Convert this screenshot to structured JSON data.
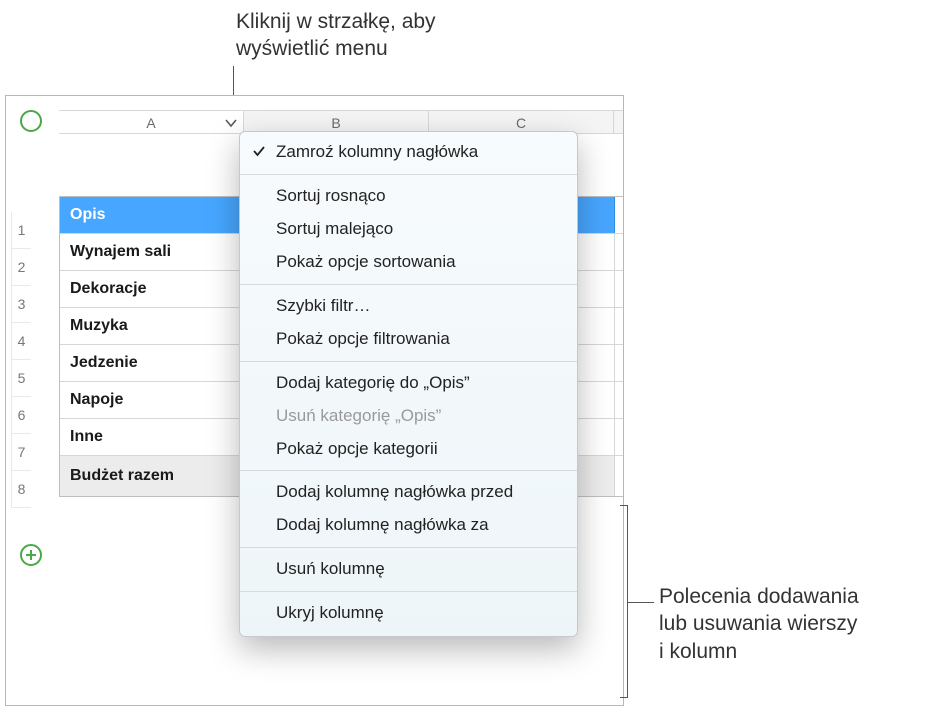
{
  "callouts": {
    "top_line1": "Kliknij w strzałkę, aby",
    "top_line2": "wyświetlić menu",
    "right_line1": "Polecenia dodawania",
    "right_line2": "lub usuwania wierszy",
    "right_line3": "i kolumn"
  },
  "columns": {
    "a": "A",
    "b": "B",
    "c": "C"
  },
  "row_numbers": [
    "1",
    "2",
    "3",
    "4",
    "5",
    "6",
    "7",
    "8"
  ],
  "table": {
    "header": "Opis",
    "rows": [
      "Wynajem sali",
      "Dekoracje",
      "Muzyka",
      "Jedzenie",
      "Napoje",
      "Inne"
    ],
    "footer": "Budżet razem"
  },
  "menu": {
    "freeze": "Zamroź kolumny nagłówka",
    "sort_asc": "Sortuj rosnąco",
    "sort_desc": "Sortuj malejąco",
    "sort_options": "Pokaż opcje sortowania",
    "quick_filter": "Szybki filtr…",
    "filter_options": "Pokaż opcje filtrowania",
    "add_category": "Dodaj kategorię do „Opis”",
    "remove_category": "Usuń kategorię „Opis”",
    "category_options": "Pokaż opcje kategorii",
    "add_col_before": "Dodaj kolumnę nagłówka przed",
    "add_col_after": "Dodaj kolumnę nagłówka za",
    "delete_col": "Usuń kolumnę",
    "hide_col": "Ukryj kolumnę"
  }
}
